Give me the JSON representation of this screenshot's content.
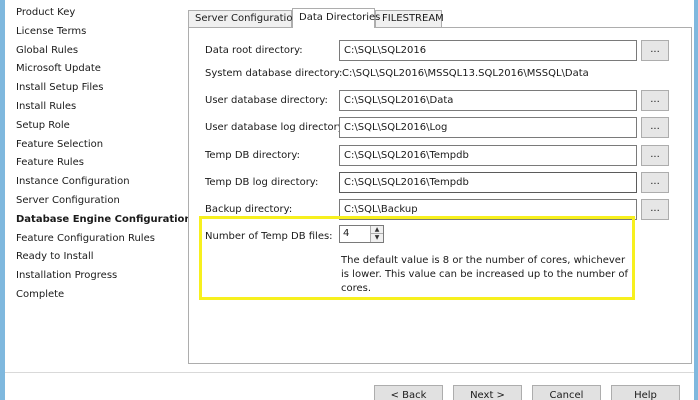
{
  "nav": {
    "items": [
      "Product Key",
      "License Terms",
      "Global Rules",
      "Microsoft Update",
      "Install Setup Files",
      "Install Rules",
      "Setup Role",
      "Feature Selection",
      "Feature Rules",
      "Instance Configuration",
      "Server Configuration",
      "Database Engine Configuration",
      "Feature Configuration Rules",
      "Ready to Install",
      "Installation Progress",
      "Complete"
    ],
    "active_index": 11
  },
  "tabs": [
    "Server Configuration",
    "Data Directories",
    "FILESTREAM"
  ],
  "form": {
    "data_root_label": "Data root directory:",
    "data_root_value": "C:\\SQL\\SQL2016",
    "system_db_label": "System database directory:",
    "system_db_value": "C:\\SQL\\SQL2016\\MSSQL13.SQL2016\\MSSQL\\Data",
    "user_db_label": "User database directory:",
    "user_db_value": "C:\\SQL\\SQL2016\\Data",
    "user_db_log_label": "User database log directory:",
    "user_db_log_value": "C:\\SQL\\SQL2016\\Log",
    "temp_db_label": "Temp DB directory:",
    "temp_db_value": "C:\\SQL\\SQL2016\\Tempdb",
    "temp_db_log_label": "Temp DB log directory:",
    "temp_db_log_value": "C:\\SQL\\SQL2016\\Tempdb",
    "backup_label": "Backup directory:",
    "backup_value": "C:\\SQL\\Backup",
    "browse_label": "...",
    "temp_files_label": "Number of Temp DB files:",
    "temp_files_value": "4",
    "hint": "The default value is 8 or the number of cores, whichever is lower. This value can be increased up to the number of cores."
  },
  "buttons": {
    "back": "< Back",
    "next": "Next >",
    "cancel": "Cancel",
    "help": "Help"
  },
  "colors": {
    "frame": "#7fb8de",
    "highlight": "#f7f01e"
  }
}
